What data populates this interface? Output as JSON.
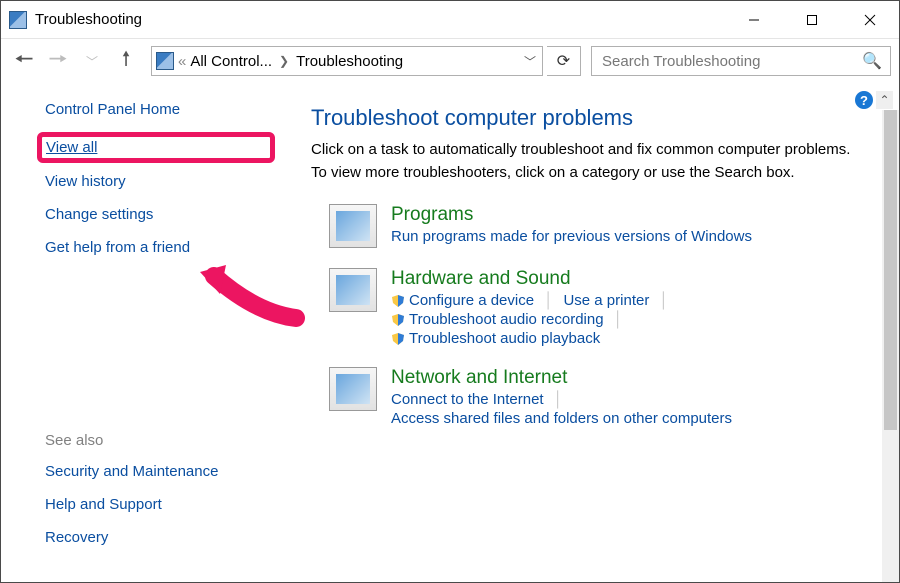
{
  "window": {
    "title": "Troubleshooting"
  },
  "address": {
    "crumb1_truncated": "All Control...",
    "crumb2": "Troubleshooting"
  },
  "search": {
    "placeholder": "Search Troubleshooting"
  },
  "sidebar": {
    "home": "Control Panel Home",
    "view_all": "View all",
    "view_history": "View history",
    "change_settings": "Change settings",
    "get_help": "Get help from a friend",
    "see_also_label": "See also",
    "see_also": {
      "security": "Security and Maintenance",
      "help": "Help and Support",
      "recovery": "Recovery"
    }
  },
  "main": {
    "heading": "Troubleshoot computer problems",
    "description": "Click on a task to automatically troubleshoot and fix common computer problems. To view more troubleshooters, click on a category or use the Search box.",
    "categories": [
      {
        "title": "Programs",
        "links": [
          {
            "label": "Run programs made for previous versions of Windows",
            "shield": false
          }
        ]
      },
      {
        "title": "Hardware and Sound",
        "links": [
          {
            "label": "Configure a device",
            "shield": true
          },
          {
            "label": "Use a printer",
            "shield": false
          },
          {
            "label": "Troubleshoot audio recording",
            "shield": true
          },
          {
            "label": "Troubleshoot audio playback",
            "shield": true
          }
        ]
      },
      {
        "title": "Network and Internet",
        "links": [
          {
            "label": "Connect to the Internet",
            "shield": false
          },
          {
            "label": "Access shared files and folders on other computers",
            "shield": false
          }
        ]
      }
    ]
  }
}
